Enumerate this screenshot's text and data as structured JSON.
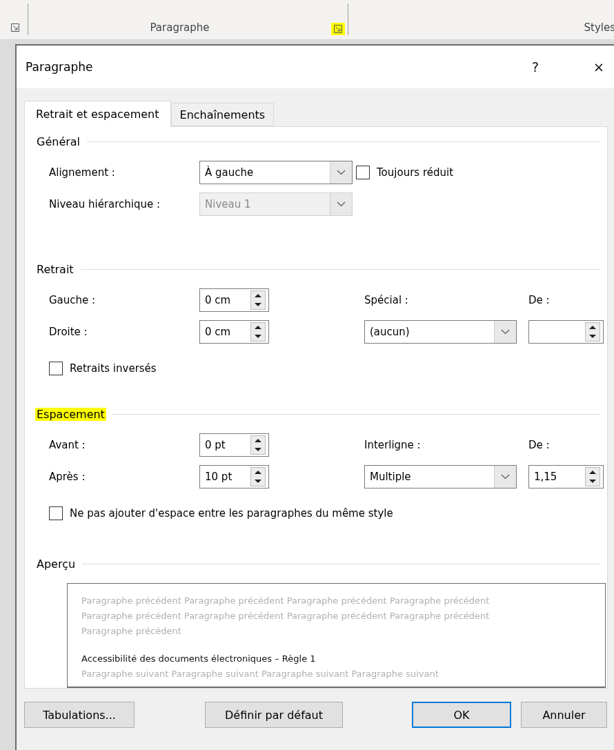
{
  "ribbon": {
    "groups": [
      {
        "label": "Paragraphe",
        "launcher_highlighted": true
      },
      {
        "label": "Styles"
      }
    ]
  },
  "window": {
    "title": "Paragraphe",
    "help": "?",
    "close": "×"
  },
  "tabs": [
    {
      "label": "Retrait et espacement",
      "selected": true
    },
    {
      "label": "Enchaînements",
      "selected": false
    }
  ],
  "sections": [
    {
      "title": "Général",
      "highlighted": false,
      "rows": [
        {
          "kind": "combo",
          "label": "Alignement :",
          "value": "À gauche",
          "disabled": false,
          "extra": {
            "kind": "checkbox",
            "label": "Toujours réduit",
            "checked": false
          }
        },
        {
          "kind": "combo",
          "label": "Niveau hiérarchique :",
          "value": "Niveau 1",
          "disabled": true
        }
      ]
    },
    {
      "title": "Retrait",
      "highlighted": false,
      "rows": [
        {
          "kind": "spin",
          "label": "Gauche :",
          "value": "0 cm",
          "label_3": "Spécial :",
          "label_4": "De :"
        },
        {
          "kind": "spin",
          "label": "Droite :",
          "value": "0 cm",
          "combo": "(aucun)",
          "spin_2": ""
        },
        {
          "kind": "checkbox",
          "label": "Retraits inversés",
          "checked": false
        }
      ]
    },
    {
      "title": "Espacement",
      "highlighted": true,
      "rows": [
        {
          "kind": "spin",
          "label": "Avant :",
          "value": "0 pt",
          "label_3": "Interligne :",
          "label_4": "De :"
        },
        {
          "kind": "spin",
          "label": "Après :",
          "value": "10 pt",
          "combo": "Multiple",
          "spin_2": "1,15"
        },
        {
          "kind": "checkbox",
          "label": "Ne pas ajouter d'espace entre les paragraphes du même style",
          "checked": false
        }
      ]
    }
  ],
  "preview": {
    "title": "Aperçu",
    "previous": "Paragraphe précédent Paragraphe précédent Paragraphe précédent Paragraphe précédent Paragraphe précédent Paragraphe précédent Paragraphe précédent Paragraphe précédent Paragraphe précédent",
    "current": "Accessibilité des documents électroniques – Règle 1",
    "next": "Paragraphe suivant Paragraphe suivant Paragraphe suivant Paragraphe suivant"
  },
  "buttons": [
    {
      "label": "Tabulations...",
      "default": false
    },
    {
      "label": "Définir par défaut",
      "default": false
    },
    {
      "label": "OK",
      "default": true
    },
    {
      "label": "Annuler",
      "default": false
    }
  ]
}
